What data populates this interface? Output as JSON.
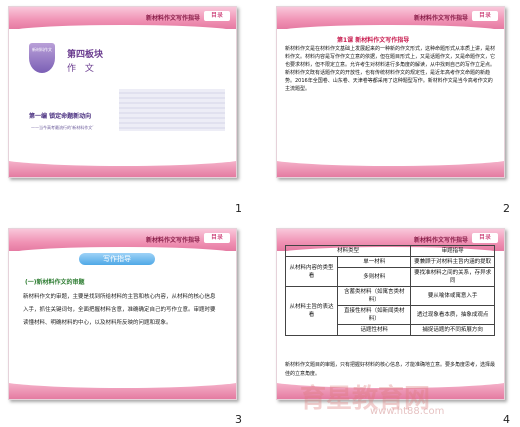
{
  "header": {
    "title": "新材料作文写作指导",
    "button": "目录"
  },
  "slide1": {
    "badge": "新材料作文",
    "module": "第四板块",
    "zuowen": "作 文",
    "section": "第一编  锁定命题新动向",
    "subtitle": "——当今高考最流行的‘新材料作文’"
  },
  "slide2": {
    "title": "第1课  新材料作文写作指导",
    "body": "新材料作文是在材料作文基础上发展起来的一种新的作文形式，这种命题形式从本质上讲，是材料作文。材料内容是写作作文立意的依据，但在题目形式上，又是话题作文，又是命题作文，它也要求材料，但不限定立意。允许考生对材料进行多角度的解读，从中找到自己的写作立足点。新材料作文既有话题作文的开放性，也有传统材料作文的规定性，是近年高考作文命题的新趋势。2016年全国卷、山东卷、天津卷等都采用了这种题型写作。新材料作文是当今高考作文的主流题型。"
  },
  "slide3": {
    "banner": "写作指导",
    "heading": "(一)新材料作文的审题",
    "body": "新材料作文的审题，主要是找到所给材料的主旨和核心内容，从材料的核心信息入手，抓住关键词句，全面把握材料含意，准确确定自己的写作立意。审题时要读懂材料、明确材料的中心，以及材料所反映的问题和现象。"
  },
  "slide4": {
    "headers": [
      "材料类型",
      "",
      "审题指导"
    ],
    "rows": [
      [
        "从材料内容的类型看",
        "单一材料",
        "要兼顾于对材料主旨内涵的提取"
      ],
      [
        "",
        "多则材料",
        "要找准材料之间的关系，存异求同"
      ],
      [
        "从材料主旨的表达看",
        "含蓄类材料（如寓言类材料）",
        "要从喻体或寓意入手"
      ],
      [
        "",
        "直接性材料（如新闻类材料）",
        "透过现象看本质，抽象成观点"
      ],
      [
        "",
        "话题性材料",
        "捕捉话题的不同拓展方向"
      ]
    ],
    "foot": "新材料作文题目的审题，只有把握好材料的核心信息，才能准确地立意。要多角度思考，选择最佳的立意角度。"
  },
  "slide_numbers": [
    "1",
    "2",
    "3",
    "4"
  ],
  "watermark": {
    "main": "育星教育网",
    "url": "www.ht88.com"
  }
}
